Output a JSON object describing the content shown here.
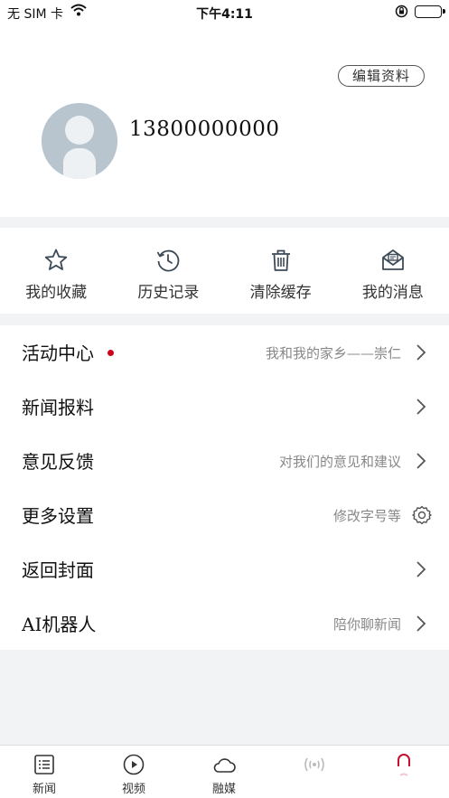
{
  "status_bar": {
    "carrier": "无 SIM 卡",
    "time": "下午4:11"
  },
  "profile": {
    "edit_label": "编辑资料",
    "phone": "13800000000"
  },
  "quick_actions": [
    {
      "label": "我的收藏",
      "icon": "star-icon"
    },
    {
      "label": "历史记录",
      "icon": "history-icon"
    },
    {
      "label": "清除缓存",
      "icon": "trash-icon"
    },
    {
      "label": "我的消息",
      "icon": "message-icon"
    }
  ],
  "menu": [
    {
      "title": "活动中心",
      "subtitle": "我和我的家乡——崇仁",
      "badge": true,
      "icon": "chevron-right-icon"
    },
    {
      "title": "新闻报料",
      "subtitle": "",
      "icon": "chevron-right-icon"
    },
    {
      "title": "意见反馈",
      "subtitle": "对我们的意见和建议",
      "icon": "chevron-right-icon"
    },
    {
      "title": "更多设置",
      "subtitle": "修改字号等",
      "icon": "gear-icon"
    },
    {
      "title": "返回封面",
      "subtitle": "",
      "icon": "chevron-right-icon"
    },
    {
      "title": "AI机器人",
      "subtitle": "陪你聊新闻",
      "icon": "chevron-right-icon"
    }
  ],
  "tabs": [
    {
      "label": "新闻",
      "icon": "news-list-icon"
    },
    {
      "label": "视频",
      "icon": "video-play-icon"
    },
    {
      "label": "融媒",
      "icon": "cloud-icon"
    },
    {
      "label": "",
      "icon": "radio-icon"
    },
    {
      "label": "",
      "icon": "profile-icon"
    }
  ],
  "colors": {
    "badge": "#d0021b",
    "background": "#f2f3f5",
    "tab_active": "#c8102e"
  }
}
